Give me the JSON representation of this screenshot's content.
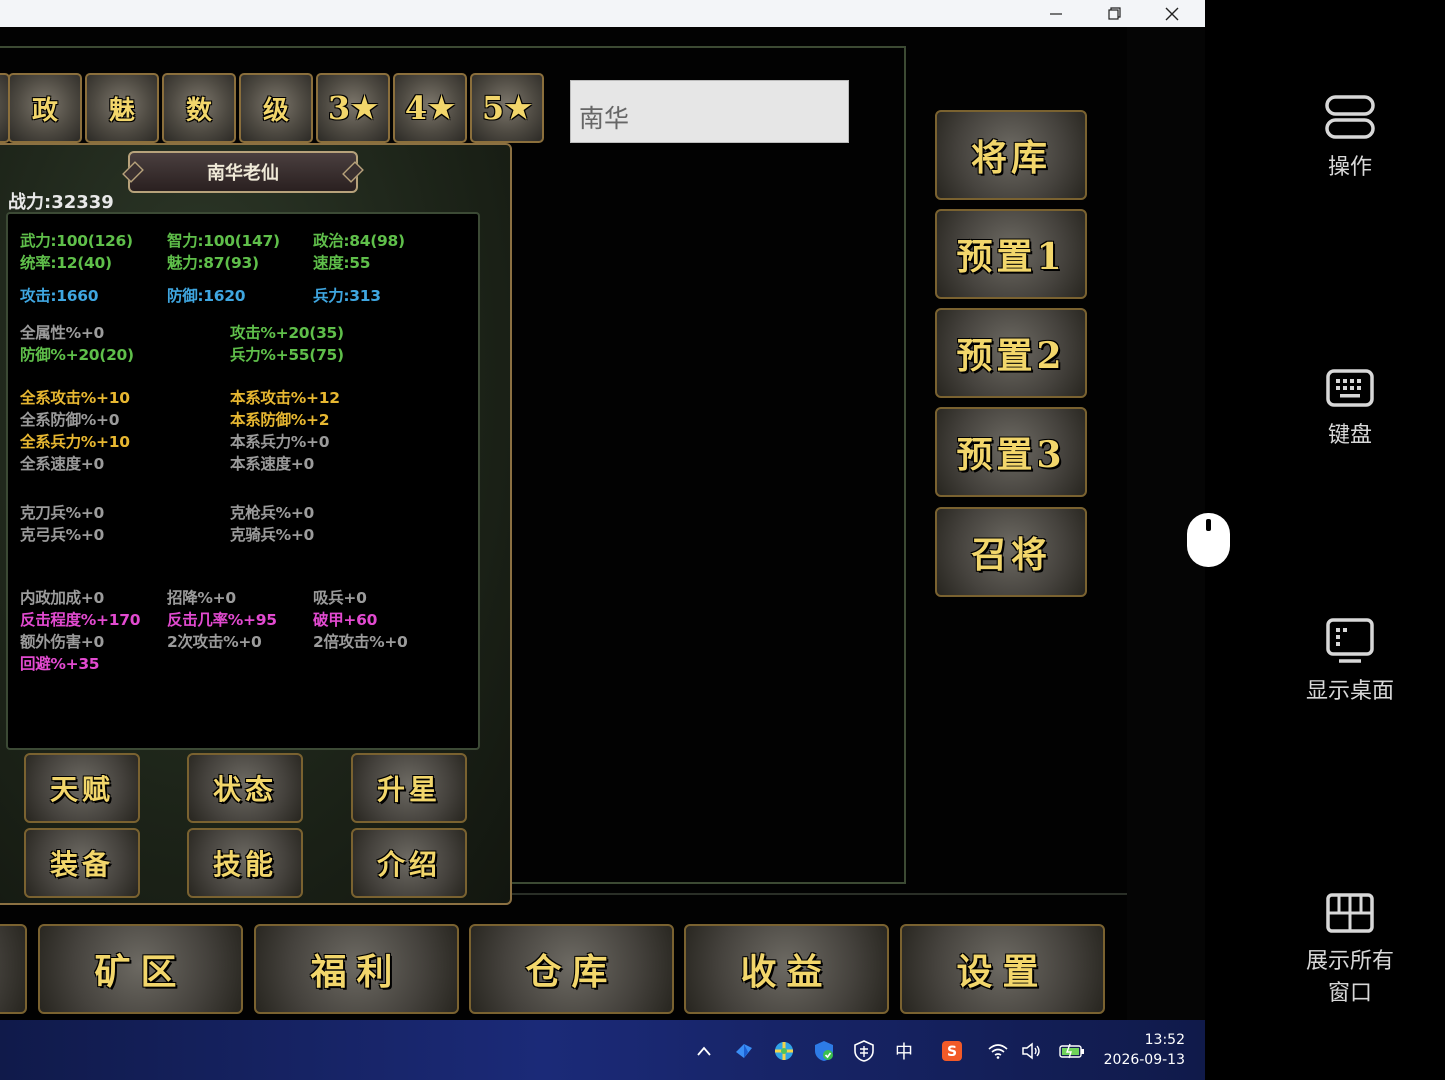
{
  "window": {
    "minimize_icon": "minimize-icon",
    "restore_icon": "restore-icon",
    "close_icon": "close-icon"
  },
  "filter_tabs": [
    {
      "label": "政"
    },
    {
      "label": "魅"
    },
    {
      "label": "数"
    },
    {
      "label": "级"
    },
    {
      "label": "3",
      "star": "★"
    },
    {
      "label": "4",
      "star": "★"
    },
    {
      "label": "5",
      "star": "★"
    }
  ],
  "search": {
    "value": "南华"
  },
  "hero": {
    "name": "南华老仙",
    "power": "战力:32339",
    "stats": {
      "wuli": "武力:100(126)",
      "zhili": "智力:100(147)",
      "zhengzhi": "政治:84(98)",
      "tongshuai": "统率:12(40)",
      "meili": "魅力:87(93)",
      "sudu": "速度:55",
      "gongji": "攻击:1660",
      "fangyu": "防御:1620",
      "bingli": "兵力:313",
      "quanshuxing": "全属性%+0",
      "gongjipct": "攻击%+20(35)",
      "fangyupct": "防御%+20(20)",
      "binglipct": "兵力%+55(75)",
      "qx_gongji": "全系攻击%+10",
      "bx_gongji": "本系攻击%+12",
      "qx_fangyu": "全系防御%+0",
      "bx_fangyu": "本系防御%+2",
      "qx_bingli": "全系兵力%+10",
      "bx_bingli": "本系兵力%+0",
      "qx_sudu": "全系速度+0",
      "bx_sudu": "本系速度+0",
      "ke_dao": "克刀兵%+0",
      "ke_qiang": "克枪兵%+0",
      "ke_gong": "克弓兵%+0",
      "ke_qi": "克骑兵%+0",
      "neizheng": "内政加成+0",
      "zhaoxiang": "招降%+0",
      "xibing": "吸兵+0",
      "fanji_cd": "反击程度%+170",
      "fanji_jl": "反击几率%+95",
      "pojia": "破甲+60",
      "ewai": "额外伤害+0",
      "erci": "2次攻击%+0",
      "beigong": "2倍攻击%+0",
      "huibi": "回避%+35"
    },
    "buttons": {
      "tianfu": "天赋",
      "zhuangtai": "状态",
      "shengxing": "升星",
      "zhuangbei": "装备",
      "jineng": "技能",
      "jieshao": "介绍"
    }
  },
  "side_buttons": [
    "将库",
    "预置1",
    "预置2",
    "预置3",
    "召将"
  ],
  "bottom_buttons": [
    "矿区",
    "福利",
    "仓库",
    "收益",
    "设置"
  ],
  "taskbar": {
    "ime": "中",
    "time": "13:52",
    "date": "2026-09-13"
  },
  "emulator_panel": {
    "operate": "操作",
    "keyboard": "键盘",
    "show_desktop": "显示桌面",
    "show_windows": "展示所有窗口"
  }
}
